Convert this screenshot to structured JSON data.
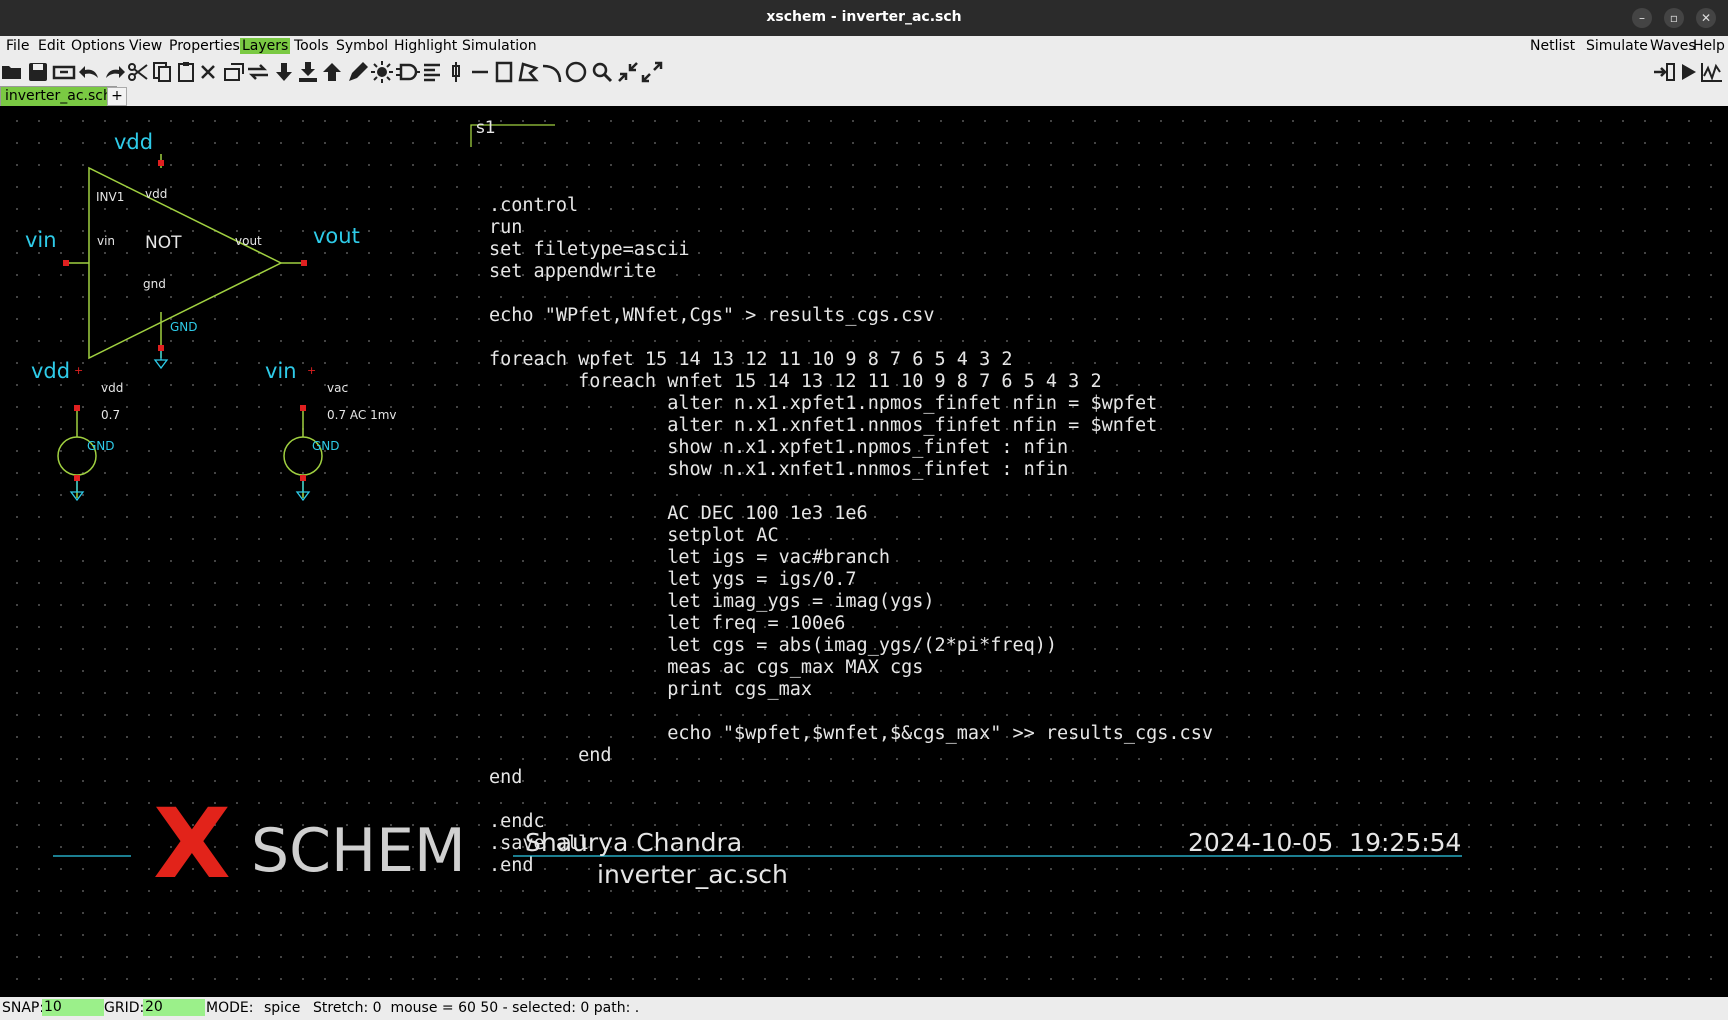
{
  "window": {
    "title": "xschem - inverter_ac.sch",
    "controls": [
      "–",
      "▫",
      "✕"
    ]
  },
  "menu": {
    "left": [
      "File",
      "Edit",
      "Options",
      "View",
      "Properties",
      "Layers",
      "Tools",
      "Symbol",
      "Highlight",
      "Simulation"
    ],
    "right": [
      "Netlist",
      "Simulate",
      "Waves",
      "Help"
    ],
    "highlighted": "Layers"
  },
  "tabs": {
    "active": "inverter_ac.sch",
    "add": "+"
  },
  "schematic": {
    "inverter": {
      "instance": "INV1",
      "symbol": "NOT",
      "pins": {
        "vdd": "vdd",
        "vin": "vin",
        "vout": "vout",
        "gnd": "gnd"
      },
      "gnd_label": "GND"
    },
    "labels": {
      "vdd_top": "vdd",
      "vin_left": "vin",
      "vout_right": "vout"
    },
    "sources": [
      {
        "net": "vdd",
        "name": "vdd",
        "value": "0.7",
        "gnd": "GND",
        "plus": "+"
      },
      {
        "net": "vin",
        "name": "vac",
        "value": "0.7 AC 1mv",
        "gnd": "GND",
        "plus": "+"
      }
    ],
    "code_block": {
      "name": "s1",
      "lines": [
        ".control",
        "run",
        "set filetype=ascii",
        "set appendwrite",
        "",
        "echo \"WPfet,WNfet,Cgs\" > results_cgs.csv",
        "",
        "foreach wpfet 15 14 13 12 11 10 9 8 7 6 5 4 3 2",
        "        foreach wnfet 15 14 13 12 11 10 9 8 7 6 5 4 3 2",
        "                alter n.x1.xpfet1.npmos_finfet nfin = $wpfet",
        "                alter n.x1.xnfet1.nnmos_finfet nfin = $wnfet",
        "                show n.x1.xpfet1.npmos_finfet : nfin",
        "                show n.x1.xnfet1.nnmos_finfet : nfin",
        "",
        "                AC DEC 100 1e3 1e6",
        "                setplot AC",
        "                let igs = vac#branch",
        "                let ygs = igs/0.7",
        "                let imag_ygs = imag(ygs)",
        "                let freq = 100e6",
        "                let cgs = abs(imag_ygs/(2*pi*freq))",
        "                meas ac cgs_max MAX cgs",
        "                print cgs_max",
        "",
        "                echo \"$wpfet,$wnfet,$&cgs_max\" >> results_cgs.csv",
        "        end",
        "end",
        "",
        ".endc",
        ".save all",
        ".end"
      ]
    },
    "title_block": {
      "logo_x": "X",
      "logo_text": "SCHEM",
      "author": "Shaurya Chandra",
      "date": "2024-10-05  19:25:54",
      "file": "inverter_ac.sch"
    }
  },
  "status": {
    "snap_label": "SNAP:",
    "snap": "10",
    "grid_label": "GRID:",
    "grid": "20",
    "mode_label": "MODE:",
    "mode": "spice",
    "rest": "Stretch: 0  mouse = 60 50 - selected: 0 path: ."
  },
  "colors": {
    "wire": "#a0d040",
    "net_label": "#2ecbe8",
    "pin": "#e02020",
    "text": "#e6e6e6",
    "logo_x": "#e2231a",
    "logo_text": "#d0d0d0",
    "menu_highlight": "#7ac943"
  }
}
